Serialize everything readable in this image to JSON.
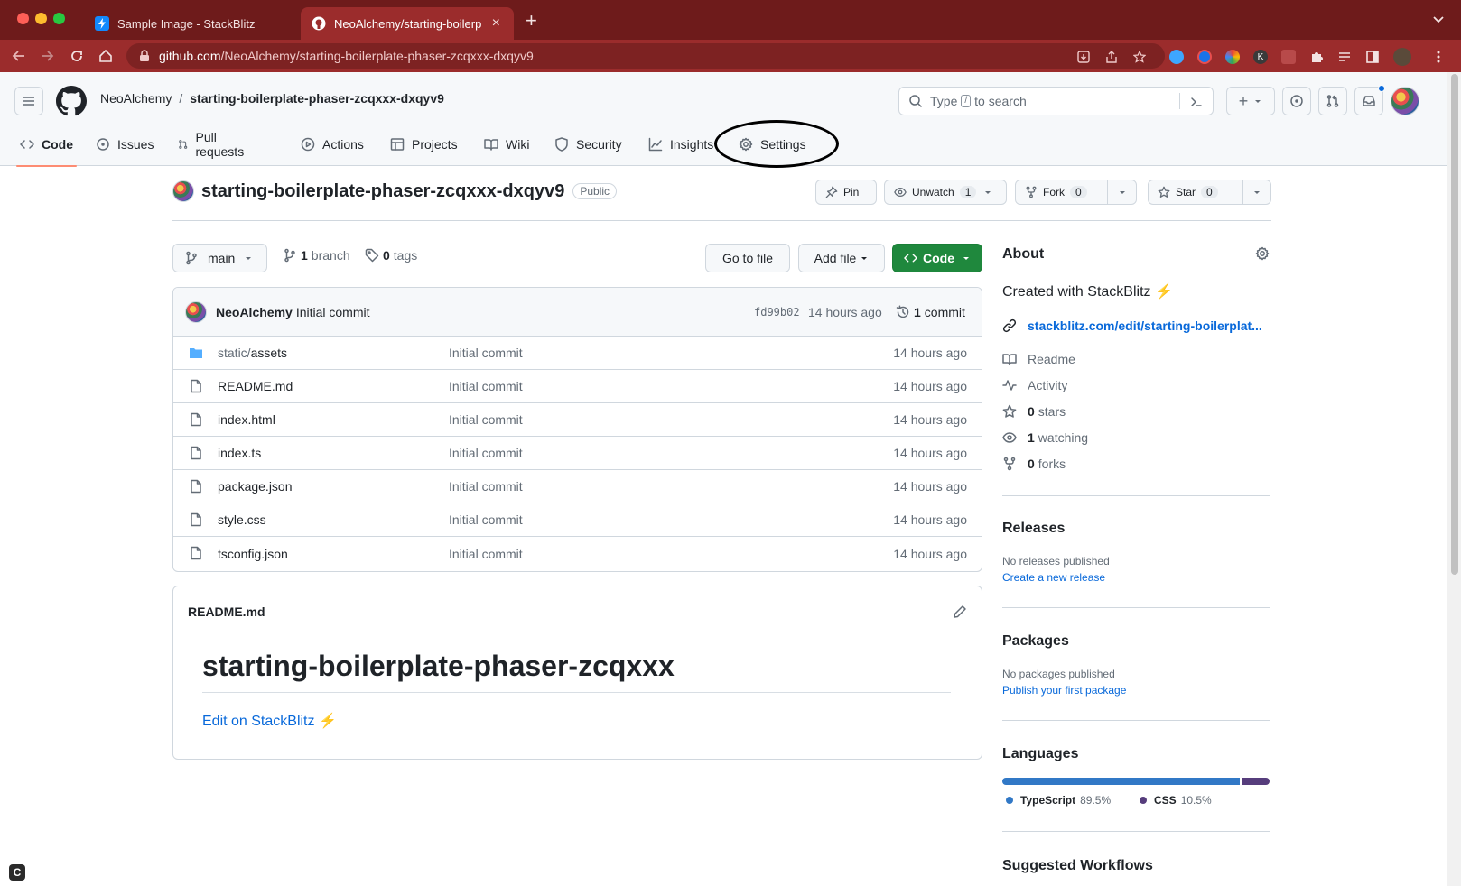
{
  "browser": {
    "tabs": [
      {
        "title": "Sample Image - StackBlitz",
        "favicon_color": "#1389fd"
      },
      {
        "title": "NeoAlchemy/starting-boilerplate",
        "favicon_color": "#ffffff"
      }
    ],
    "url_host": "github.com",
    "url_path": "/NeoAlchemy/starting-boilerplate-phaser-zcqxxx-dxqyv9",
    "chrome_color": "#6e1b1b"
  },
  "header": {
    "owner": "NeoAlchemy",
    "separator": "/",
    "repo": "starting-boilerplate-phaser-zcqxxx-dxqyv9",
    "search_prefix": "Type",
    "search_key": "/",
    "search_suffix": "to search",
    "new_label": "+"
  },
  "nav": [
    {
      "label": "Code",
      "icon": "code-icon"
    },
    {
      "label": "Issues",
      "icon": "issue-icon"
    },
    {
      "label": "Pull requests",
      "icon": "pull-request-icon"
    },
    {
      "label": "Actions",
      "icon": "play-icon"
    },
    {
      "label": "Projects",
      "icon": "table-icon"
    },
    {
      "label": "Wiki",
      "icon": "book-icon"
    },
    {
      "label": "Security",
      "icon": "shield-icon"
    },
    {
      "label": "Insights",
      "icon": "graph-icon"
    },
    {
      "label": "Settings",
      "icon": "gear-icon"
    }
  ],
  "repo_head": {
    "name": "starting-boilerplate-phaser-zcqxxx-dxqyv9",
    "visibility": "Public",
    "pin_label": "Pin",
    "watch_label": "Unwatch",
    "watch_count": "1",
    "fork_label": "Fork",
    "fork_count": "0",
    "star_label": "Star",
    "star_count": "0"
  },
  "toolbar": {
    "branch": "main",
    "branch_count": "1",
    "branch_label": "branch",
    "tag_count": "0",
    "tag_label": "tags",
    "goto_file": "Go to file",
    "add_file": "Add file",
    "code": "Code"
  },
  "commit": {
    "author": "NeoAlchemy",
    "message": "Initial commit",
    "sha": "fd99b02",
    "age": "14 hours ago",
    "count": "1",
    "count_label": "commit"
  },
  "files": [
    {
      "dir": "static/",
      "name": "assets",
      "type": "folder",
      "message": "Initial commit",
      "age": "14 hours ago"
    },
    {
      "dir": "",
      "name": "README.md",
      "type": "file",
      "message": "Initial commit",
      "age": "14 hours ago"
    },
    {
      "dir": "",
      "name": "index.html",
      "type": "file",
      "message": "Initial commit",
      "age": "14 hours ago"
    },
    {
      "dir": "",
      "name": "index.ts",
      "type": "file",
      "message": "Initial commit",
      "age": "14 hours ago"
    },
    {
      "dir": "",
      "name": "package.json",
      "type": "file",
      "message": "Initial commit",
      "age": "14 hours ago"
    },
    {
      "dir": "",
      "name": "style.css",
      "type": "file",
      "message": "Initial commit",
      "age": "14 hours ago"
    },
    {
      "dir": "",
      "name": "tsconfig.json",
      "type": "file",
      "message": "Initial commit",
      "age": "14 hours ago"
    }
  ],
  "readme": {
    "filename": "README.md",
    "heading": "starting-boilerplate-phaser-zcqxxx",
    "link": "Edit on StackBlitz ⚡️"
  },
  "about": {
    "title": "About",
    "description": "Created with StackBlitz ⚡️",
    "website": "stackblitz.com/edit/starting-boilerplat...",
    "readme": "Readme",
    "activity": "Activity",
    "stars_count": "0",
    "stars_label": "stars",
    "watching_count": "1",
    "watching_label": "watching",
    "forks_count": "0",
    "forks_label": "forks"
  },
  "releases": {
    "title": "Releases",
    "empty": "No releases published",
    "create": "Create a new release"
  },
  "packages": {
    "title": "Packages",
    "empty": "No packages published",
    "publish": "Publish your first package"
  },
  "languages": {
    "title": "Languages",
    "items": [
      {
        "name": "TypeScript",
        "percent": "89.5%",
        "value": 89.5,
        "color": "#3178c6"
      },
      {
        "name": "CSS",
        "percent": "10.5%",
        "value": 10.5,
        "color": "#563d7c"
      }
    ]
  },
  "suggested": {
    "title": "Suggested Workflows"
  }
}
